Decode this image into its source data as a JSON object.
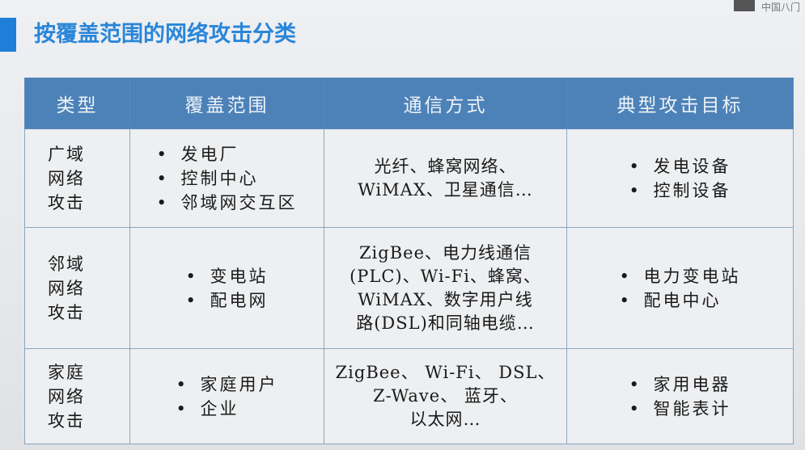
{
  "header": {
    "title": "按覆盖范围的网络攻击分类",
    "corner_text": "中国八门"
  },
  "table": {
    "headers": [
      "类型",
      "覆盖范围",
      "通信方式",
      "典型攻击目标"
    ],
    "rows": [
      {
        "type": [
          "广域",
          "网络",
          "攻击"
        ],
        "coverage": [
          "发电厂",
          "控制中心",
          "邻域网交互区"
        ],
        "comm": [
          "光纤、蜂窝网络、",
          "WiMAX、卫星通信…"
        ],
        "targets": [
          "发电设备",
          "控制设备"
        ]
      },
      {
        "type": [
          "邻域",
          "网络",
          "攻击"
        ],
        "coverage": [
          "变电站",
          "配电网"
        ],
        "comm": [
          "ZigBee、电力线通信",
          "(PLC)、Wi-Fi、蜂窝、",
          "WiMAX、数字用户线",
          "路(DSL)和同轴电缆…"
        ],
        "targets": [
          "电力变电站",
          "配电中心"
        ]
      },
      {
        "type": [
          "家庭",
          "网络",
          "攻击"
        ],
        "coverage": [
          "家庭用户",
          "企业"
        ],
        "comm": [
          "ZigBee、 Wi-Fi、 DSL、",
          "Z-Wave、 蓝牙、",
          "以太网…"
        ],
        "targets": [
          "家用电器",
          "智能表计"
        ]
      }
    ]
  }
}
